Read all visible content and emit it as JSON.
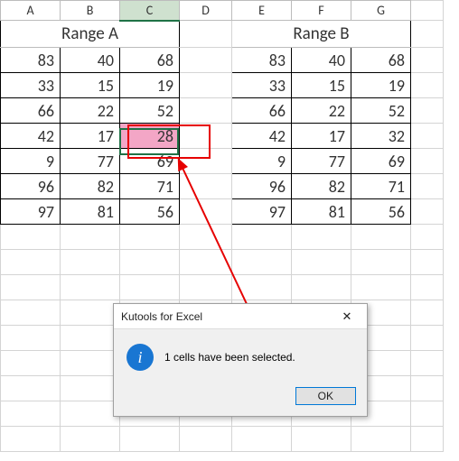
{
  "columns": [
    "A",
    "B",
    "C",
    "D",
    "E",
    "F",
    "G"
  ],
  "rangeA": {
    "title": "Range A"
  },
  "rangeB": {
    "title": "Range B"
  },
  "dataA": [
    [
      83,
      40,
      68
    ],
    [
      33,
      15,
      19
    ],
    [
      66,
      22,
      52
    ],
    [
      42,
      17,
      28
    ],
    [
      9,
      77,
      69
    ],
    [
      96,
      82,
      71
    ],
    [
      97,
      81,
      56
    ]
  ],
  "dataB": [
    [
      83,
      40,
      68
    ],
    [
      33,
      15,
      19
    ],
    [
      66,
      22,
      52
    ],
    [
      42,
      17,
      32
    ],
    [
      9,
      77,
      69
    ],
    [
      96,
      82,
      71
    ],
    [
      97,
      81,
      56
    ]
  ],
  "highlight": {
    "col": "C",
    "row": 4,
    "value": 28,
    "fill": "#f3a6c6"
  },
  "dialog": {
    "title": "Kutools for Excel",
    "message": "1 cells have been selected.",
    "ok": "OK",
    "close": "✕"
  },
  "icons": {
    "info": "i"
  },
  "colors": {
    "header_fill": "#5b9bd5",
    "accent": "#1f7246",
    "annotation": "#e60000"
  },
  "chart_data": {
    "type": "table",
    "tables": [
      {
        "name": "Range A",
        "columns": [
          "A",
          "B",
          "C"
        ],
        "rows": [
          [
            83,
            40,
            68
          ],
          [
            33,
            15,
            19
          ],
          [
            66,
            22,
            52
          ],
          [
            42,
            17,
            28
          ],
          [
            9,
            77,
            69
          ],
          [
            96,
            82,
            71
          ],
          [
            97,
            81,
            56
          ]
        ]
      },
      {
        "name": "Range B",
        "columns": [
          "E",
          "F",
          "G"
        ],
        "rows": [
          [
            83,
            40,
            68
          ],
          [
            33,
            15,
            19
          ],
          [
            66,
            22,
            52
          ],
          [
            42,
            17,
            32
          ],
          [
            9,
            77,
            69
          ],
          [
            96,
            82,
            71
          ],
          [
            97,
            81,
            56
          ]
        ]
      }
    ]
  }
}
